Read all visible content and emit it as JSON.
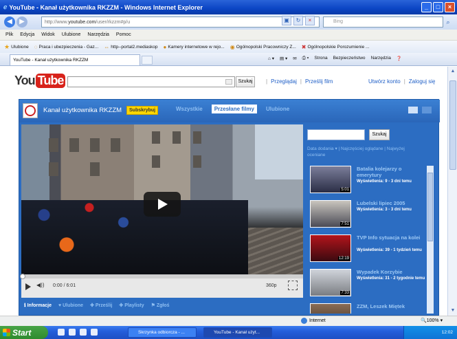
{
  "window": {
    "title": "YouTube - Kanał użytkownika RKZZM - Windows Internet Explorer"
  },
  "address": {
    "url_prefix": "http://www.",
    "url_domain": "youtube.com",
    "url_suffix": "/user/rkzzm#p/u",
    "search_placeholder": "Bing"
  },
  "menu": [
    "Plik",
    "Edycja",
    "Widok",
    "Ulubione",
    "Narzędzia",
    "Pomoc"
  ],
  "favorites": {
    "label": "Ulubione",
    "items": [
      "Praca i ubezpieczenia - Gaz...",
      "http--portal2.mediaskop",
      "Kamery internetowe w rejo...",
      "Ogólnopolski Pracowniczy Z...",
      "Ogólnopolskie Porozumienie ..."
    ]
  },
  "tab": {
    "title": "YouTube - Kanał użytkownika RKZZM"
  },
  "commandbar": [
    "Strona",
    "Bezpieczeństwo",
    "Narzędzia"
  ],
  "yt": {
    "logo_you": "You",
    "logo_tube": "Tube",
    "search_button": "Szukaj",
    "nav_links": [
      "Przeglądaj",
      "Prześlij film"
    ],
    "account_links": [
      "Utwórz konto",
      "Zaloguj się"
    ]
  },
  "channel": {
    "name": "Kanał użytkownika RKZZM",
    "subscribe": "Subskrybuj",
    "tabs": [
      "Wszystkie",
      "Przesłane filmy",
      "Ulubione"
    ],
    "active_tab": 1
  },
  "player": {
    "time": "0:00 / 6:01",
    "quality": "360p",
    "progress": 0
  },
  "infobar": [
    "Informacje",
    "Ulubione",
    "Prześlij",
    "Playlisty",
    "Zgłoś"
  ],
  "sidebar": {
    "search_button": "Szukaj",
    "sort_text": "Data dodania ▾ | Najczęściej oglądane | Najwyżej oceniane",
    "videos": [
      {
        "title": "Batalia kolejarzy o emerytury",
        "views": "Wyświetlenia: 9 - 3 dni temu",
        "duration": "5:01"
      },
      {
        "title": "Lubelski lipiec 2005",
        "views": "Wyświetlenia: 3 - 3 dni temu",
        "duration": "7:51"
      },
      {
        "title": "TVP Info sytuacja na kolei",
        "views": "Wyświetlenia: 39 - 1 tydzień temu",
        "duration": "12:19"
      },
      {
        "title": "Wypadek Korzybie",
        "views": "Wyświetlenia: 31 - 2 tygodnie temu",
        "duration": "7:33"
      },
      {
        "title": "ZZM, Leszek Miętek",
        "views": "",
        "duration": ""
      }
    ]
  },
  "status": {
    "zone": "Internet",
    "zoom": "100%"
  },
  "taskbar": {
    "start": "Start",
    "items": [
      "Skrzynka odbiorcza - ...",
      "YouTube - Kanał użyt..."
    ],
    "clock": "12:02"
  }
}
